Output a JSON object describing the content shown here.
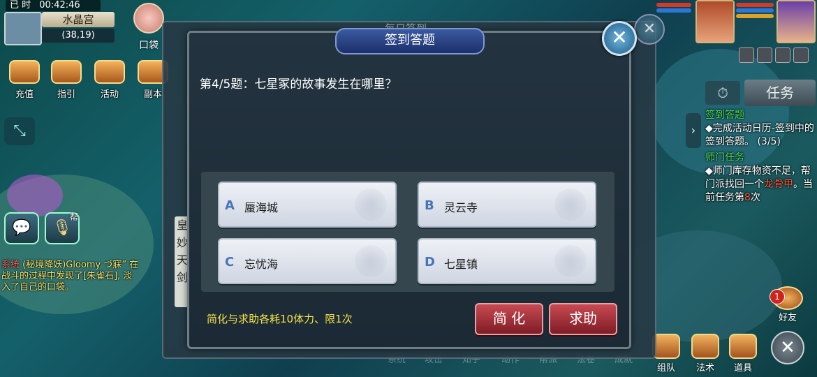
{
  "status_bar": {
    "time": "00:42:46",
    "prefix": "已 时"
  },
  "location": {
    "map_name": "水晶宫",
    "coords": "(38,19)"
  },
  "pocket": {
    "label": "口袋"
  },
  "left_menu": [
    {
      "label": "充值",
      "icon": "treasure-chest-icon"
    },
    {
      "label": "指引",
      "icon": "scroll-icon"
    },
    {
      "label": "活动",
      "icon": "activity-icon"
    },
    {
      "label": "副本",
      "icon": "dungeon-icon"
    }
  ],
  "guild_tag": "帮",
  "chat_log": {
    "sys_tag": "系统",
    "line1": "(秘境降妖)Gloomy づ寐” 在",
    "line2": "战斗的过程中发现了[朱雀石], 淡",
    "line3": "入了自己的口袋。"
  },
  "under_window": {
    "title": "每日签到",
    "side_text": [
      "皇",
      "妙",
      "天",
      "剑"
    ]
  },
  "dialog": {
    "title": "签到答题",
    "question": "第4/5题：七星冢的故事发生在哪里？",
    "options": [
      {
        "letter": "A",
        "text": "蜃海城"
      },
      {
        "letter": "B",
        "text": "灵云寺"
      },
      {
        "letter": "C",
        "text": "忘忧海"
      },
      {
        "letter": "D",
        "text": "七星镇"
      }
    ],
    "hint": "简化与求助各耗10体力、限1次",
    "simplify_label": "简 化",
    "help_label": "求助"
  },
  "right_hud": {
    "task_tab": "任务",
    "tracker": {
      "quest1_title": "签到答题",
      "quest1_desc": "◆完成活动日历-签到中的签到答题。 (3/5)",
      "quest2_title": "师门任务",
      "quest2_desc_a": "◆师门库存物资不足，帮门派找回一个",
      "quest2_item": "龙骨甲",
      "quest2_desc_b": "。当前任务第",
      "quest2_num": "8",
      "quest2_desc_c": "次"
    },
    "friends": {
      "label": "好友",
      "badge": "1"
    }
  },
  "bottom_bar": [
    {
      "label": "组队",
      "icon": "team-icon"
    },
    {
      "label": "法术",
      "icon": "magic-icon"
    },
    {
      "label": "道具",
      "icon": "item-chest-icon"
    }
  ],
  "dim_bottom_labels": [
    "系统",
    "攻击",
    "知子",
    "动作",
    "帮派",
    "法卷",
    "成就"
  ],
  "colors": {
    "accent_blue": "#3a5aa0",
    "button_red": "#c84a52",
    "hint_yellow": "#f5e44a",
    "quest_green": "#45e05a"
  }
}
